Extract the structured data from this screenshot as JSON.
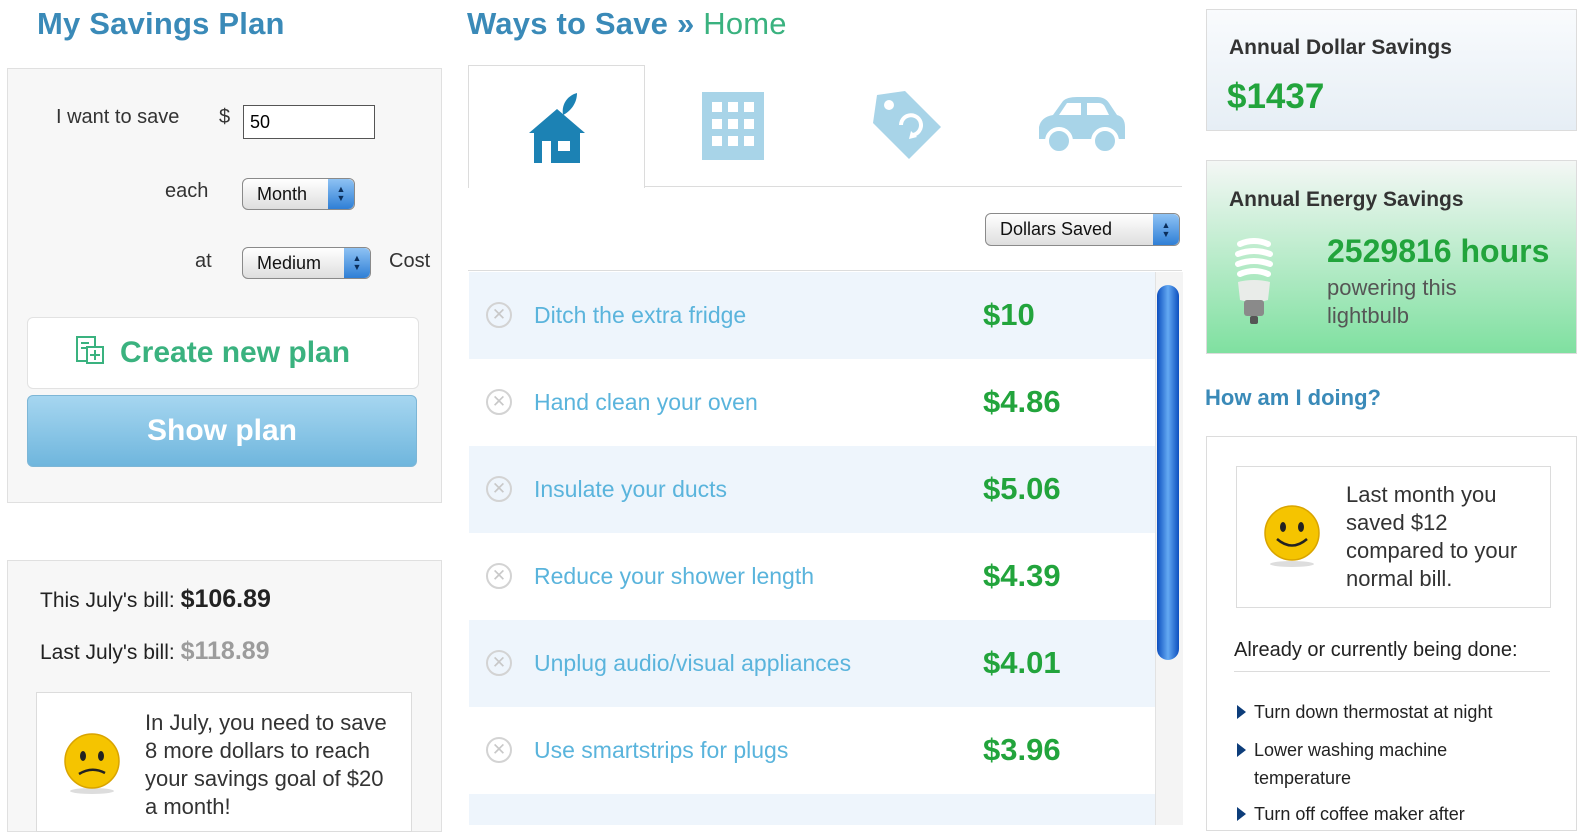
{
  "left": {
    "title": "My Savings Plan",
    "want_label": "I want to save",
    "currency": "$",
    "amount_value": "50",
    "each_label": "each",
    "period_selected": "Month",
    "at_label": "at",
    "cost_selected": "Medium",
    "cost_label": "Cost",
    "create_label": "Create new plan",
    "show_label": "Show plan",
    "this_bill_label": "This July's bill:",
    "this_bill_value": "$106.89",
    "last_bill_label": "Last July's bill:",
    "last_bill_value": "$118.89",
    "message_lines": [
      "In July, you need to save",
      "8 more dollars to reach",
      "your savings goal of $20",
      "a month!"
    ]
  },
  "middle": {
    "breadcrumb_root": "Ways to Save",
    "breadcrumb_sep": "»",
    "breadcrumb_current": "Home",
    "tabs": [
      {
        "icon": "home-icon",
        "active": true
      },
      {
        "icon": "building-icon",
        "active": false
      },
      {
        "icon": "recycle-tag-icon",
        "active": false
      },
      {
        "icon": "car-icon",
        "active": false
      }
    ],
    "sort_selected": "Dollars Saved",
    "items": [
      {
        "name": "Ditch the extra fridge",
        "amount": "$10"
      },
      {
        "name": "Hand clean your oven",
        "amount": "$4.86"
      },
      {
        "name": "Insulate your ducts",
        "amount": "$5.06"
      },
      {
        "name": "Reduce your shower length",
        "amount": "$4.39"
      },
      {
        "name": "Unplug audio/visual appliances",
        "amount": "$4.01"
      },
      {
        "name": "Use smartstrips for plugs",
        "amount": "$3.96"
      }
    ]
  },
  "right": {
    "dollar_title": "Annual Dollar Savings",
    "dollar_value": "$1437",
    "energy_title": "Annual Energy Savings",
    "energy_value": "2529816 hours",
    "energy_desc_lines": [
      "powering this",
      "lightbulb"
    ],
    "how_title": "How am I doing?",
    "how_message_lines": [
      "Last month you",
      "saved $12",
      "compared to your",
      "normal bill."
    ],
    "done_title": "Already or currently being done:",
    "done_items": [
      {
        "lines": [
          "Turn down thermostat at night"
        ]
      },
      {
        "lines": [
          "Lower washing machine",
          "temperature"
        ]
      },
      {
        "lines": [
          "Turn off coffee maker after"
        ]
      }
    ]
  }
}
